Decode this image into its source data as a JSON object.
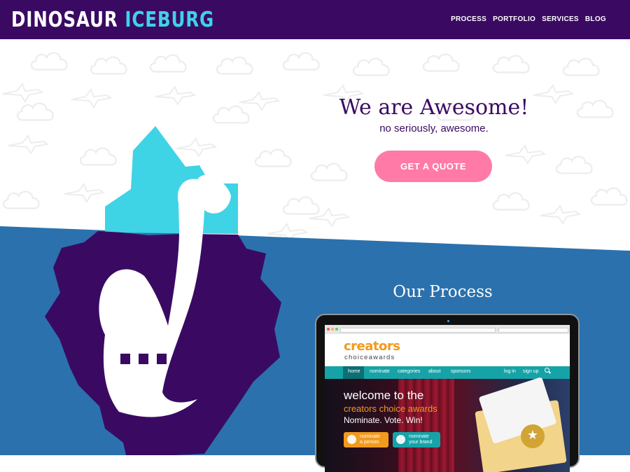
{
  "brand": {
    "word1": "DINOSAUR",
    "word2": "ICEBURG"
  },
  "nav": {
    "items": [
      "PROCESS",
      "PORTFOLIO",
      "SERVICES",
      "BLOG"
    ]
  },
  "hero": {
    "title": "We are Awesome!",
    "subtitle": "no seriously, awesome.",
    "cta_label": "GET A QUOTE"
  },
  "process": {
    "title": "Our Process"
  },
  "device_screen": {
    "site_logo_top": "creators",
    "site_logo_bottom": "choiceawards",
    "nav": [
      "home",
      "nominate",
      "categories",
      "about",
      "sponsors",
      "log in",
      "sign up"
    ],
    "welcome_line1": "welcome to the",
    "welcome_line2": "creators choice awards",
    "welcome_line3": "Nominate. Vote. Win!",
    "button1_line1": "nominate",
    "button1_line2": "a person",
    "button2_line1": "nominate",
    "button2_line2": "your brand"
  },
  "colors": {
    "header_bg": "#3a0a63",
    "accent_cyan": "#3fd3e6",
    "band_blue": "#2b71ad",
    "cta_pink": "#ff7aa6",
    "rock_purple": "#3a0a63"
  },
  "icons": [
    "cloud-icon",
    "pterodactyl-icon",
    "search-icon",
    "star-medal-icon"
  ]
}
